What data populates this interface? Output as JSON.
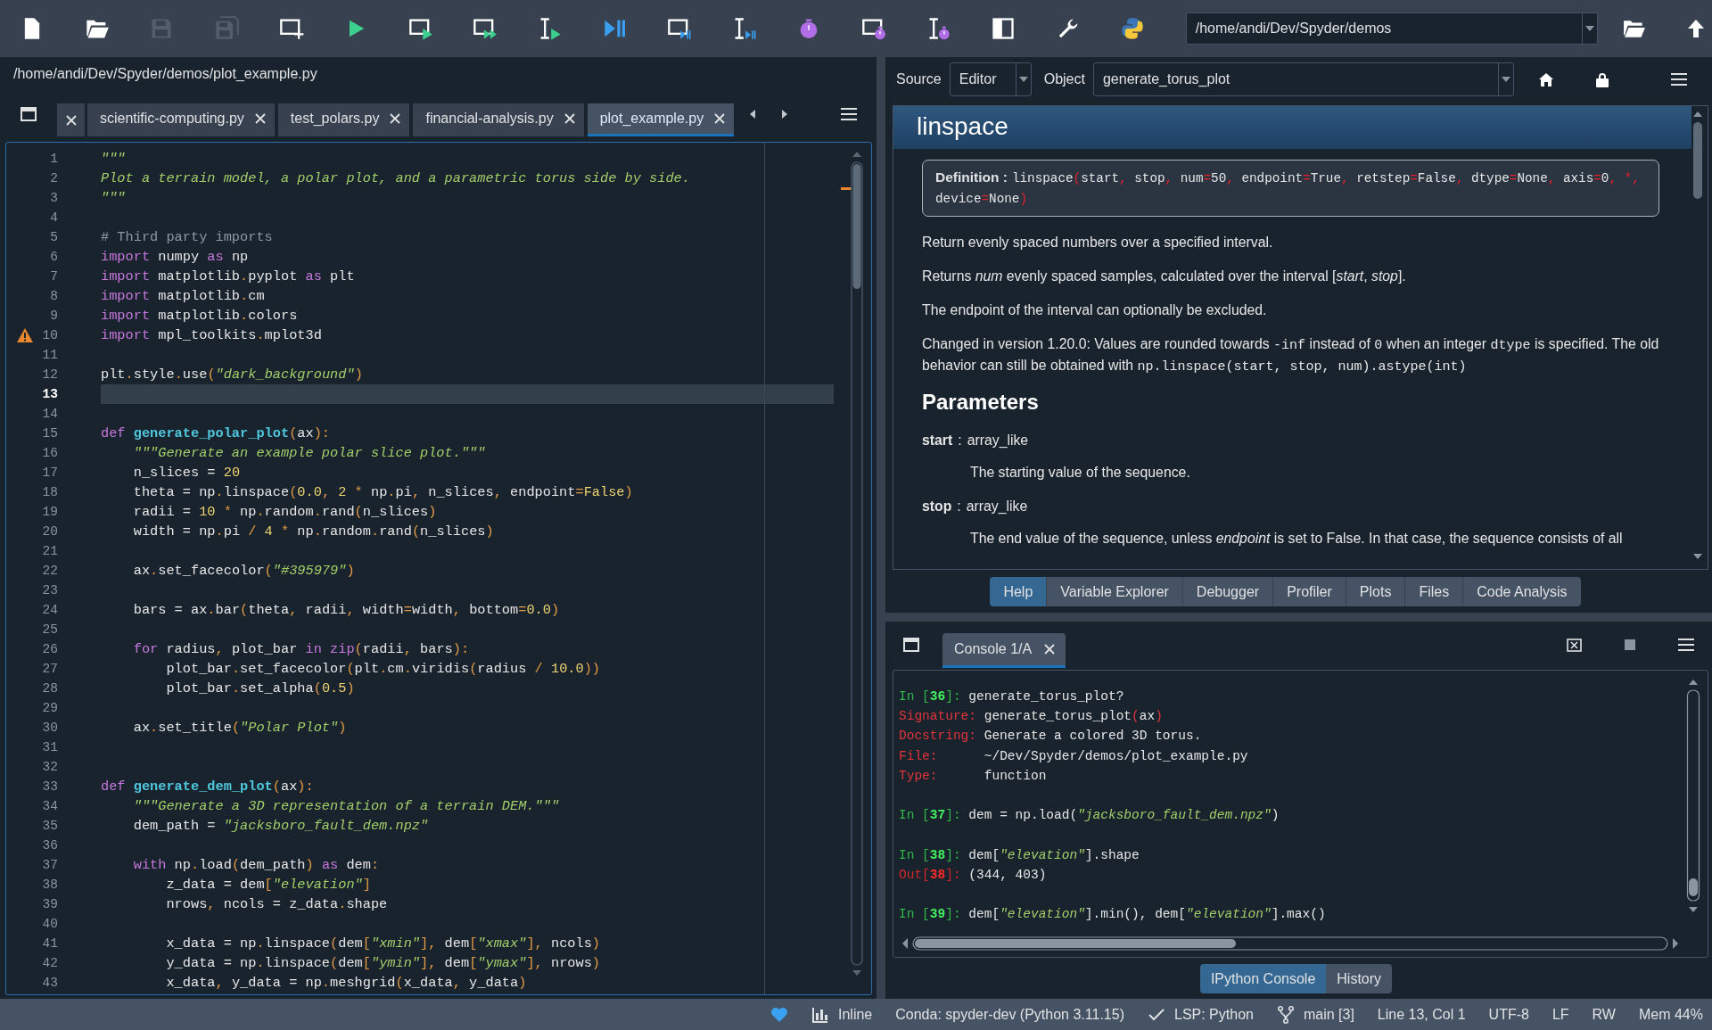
{
  "toolbar": {
    "buttons": [
      {
        "kind": "new",
        "disabled": false
      },
      {
        "kind": "open",
        "disabled": false
      },
      {
        "kind": "save",
        "disabled": true
      },
      {
        "kind": "saveall",
        "disabled": true
      },
      {
        "kind": "newcell",
        "disabled": false
      },
      {
        "kind": "run",
        "disabled": false
      },
      {
        "kind": "runcell",
        "disabled": false
      },
      {
        "kind": "runadvance",
        "disabled": false
      },
      {
        "kind": "runselection",
        "disabled": false
      },
      {
        "kind": "debug",
        "disabled": false
      },
      {
        "kind": "debugcell",
        "disabled": false
      },
      {
        "kind": "debugselection",
        "disabled": false
      },
      {
        "kind": "profile",
        "disabled": false
      },
      {
        "kind": "profilecell",
        "disabled": false
      },
      {
        "kind": "profileselection",
        "disabled": false
      },
      {
        "kind": "maximize",
        "disabled": false
      },
      {
        "kind": "preferences",
        "disabled": false
      },
      {
        "kind": "pythonpath",
        "disabled": false
      }
    ],
    "path": "/home/andi/Dev/Spyder/demos"
  },
  "editor": {
    "file_path": "/home/andi/Dev/Spyder/demos/plot_example.py",
    "tabs": [
      {
        "label": "scientific-computing.py",
        "selected": false
      },
      {
        "label": "test_polars.py",
        "selected": false
      },
      {
        "label": "financial-analysis.py",
        "selected": false
      },
      {
        "label": "plot_example.py",
        "selected": true
      }
    ],
    "lines": [
      {
        "n": "1",
        "current": false,
        "warning": false,
        "tokens": [
          {
            "kind": "string",
            "text": "\"\"\""
          }
        ]
      },
      {
        "n": "2",
        "current": false,
        "warning": false,
        "tokens": [
          {
            "kind": "string",
            "text": "Plot a terrain model, a polar plot, and a parametric torus side by side."
          }
        ]
      },
      {
        "n": "3",
        "current": false,
        "warning": false,
        "tokens": [
          {
            "kind": "string",
            "text": "\"\"\""
          }
        ]
      },
      {
        "n": "4",
        "current": false,
        "warning": false
      },
      {
        "n": "5",
        "current": false,
        "warning": false,
        "tokens": [
          {
            "kind": "comment",
            "text": "# Third party imports"
          }
        ]
      },
      {
        "n": "6",
        "current": false,
        "warning": false,
        "tokens": [
          {
            "kind": "keyword",
            "text": "import"
          },
          {
            "kind": "plain",
            "text": " numpy "
          },
          {
            "kind": "keyword",
            "text": "as"
          },
          {
            "kind": "plain",
            "text": " np"
          }
        ]
      },
      {
        "n": "7",
        "current": false,
        "warning": false,
        "tokens": [
          {
            "kind": "keyword",
            "text": "import"
          },
          {
            "kind": "plain",
            "text": " matplotlib"
          },
          {
            "kind": "punct",
            "text": "."
          },
          {
            "kind": "plain",
            "text": "pyplot "
          },
          {
            "kind": "keyword",
            "text": "as"
          },
          {
            "kind": "plain",
            "text": " plt"
          }
        ]
      },
      {
        "n": "8",
        "current": false,
        "warning": false,
        "tokens": [
          {
            "kind": "keyword",
            "text": "import"
          },
          {
            "kind": "plain",
            "text": " matplotlib"
          },
          {
            "kind": "punct",
            "text": "."
          },
          {
            "kind": "plain",
            "text": "cm"
          }
        ]
      },
      {
        "n": "9",
        "current": false,
        "warning": false,
        "tokens": [
          {
            "kind": "keyword",
            "text": "import"
          },
          {
            "kind": "plain",
            "text": " matplotlib"
          },
          {
            "kind": "punct",
            "text": "."
          },
          {
            "kind": "plain",
            "text": "colors"
          }
        ]
      },
      {
        "n": "10",
        "current": false,
        "warning": true,
        "tokens": [
          {
            "kind": "keyword",
            "text": "import"
          },
          {
            "kind": "plain",
            "text": " mpl_toolkits"
          },
          {
            "kind": "punct",
            "text": "."
          },
          {
            "kind": "plain",
            "text": "mplot3d"
          }
        ]
      },
      {
        "n": "11",
        "current": false,
        "warning": false
      },
      {
        "n": "12",
        "current": false,
        "warning": false,
        "tokens": [
          {
            "kind": "plain",
            "text": "plt"
          },
          {
            "kind": "punct",
            "text": "."
          },
          {
            "kind": "plain",
            "text": "style"
          },
          {
            "kind": "punct",
            "text": "."
          },
          {
            "kind": "plain",
            "text": "use"
          },
          {
            "kind": "punct",
            "text": "("
          },
          {
            "kind": "string",
            "text": "\"dark_background\""
          },
          {
            "kind": "punct",
            "text": ")"
          }
        ]
      },
      {
        "n": "13",
        "current": true,
        "warning": false
      },
      {
        "n": "14",
        "current": false,
        "warning": false
      },
      {
        "n": "15",
        "current": false,
        "warning": false,
        "tokens": [
          {
            "kind": "keyword",
            "text": "def "
          },
          {
            "kind": "function",
            "text": "generate_polar_plot"
          },
          {
            "kind": "punct",
            "text": "("
          },
          {
            "kind": "plain",
            "text": "ax"
          },
          {
            "kind": "punct",
            "text": "):"
          }
        ]
      },
      {
        "n": "16",
        "current": false,
        "warning": false,
        "tokens": [
          {
            "kind": "string",
            "text": "    \"\"\"Generate an example polar slice plot.\"\"\""
          }
        ]
      },
      {
        "n": "17",
        "current": false,
        "warning": false,
        "tokens": [
          {
            "kind": "plain",
            "text": "    n_slices = "
          },
          {
            "kind": "number",
            "text": "20"
          }
        ]
      },
      {
        "n": "18",
        "current": false,
        "warning": false,
        "tokens": [
          {
            "kind": "plain",
            "text": "    theta = np"
          },
          {
            "kind": "punct",
            "text": "."
          },
          {
            "kind": "plain",
            "text": "linspace"
          },
          {
            "kind": "punct",
            "text": "("
          },
          {
            "kind": "number",
            "text": "0.0"
          },
          {
            "kind": "punct",
            "text": ", "
          },
          {
            "kind": "number",
            "text": "2"
          },
          {
            "kind": "punct",
            "text": " * "
          },
          {
            "kind": "plain",
            "text": "np"
          },
          {
            "kind": "punct",
            "text": "."
          },
          {
            "kind": "plain",
            "text": "pi"
          },
          {
            "kind": "punct",
            "text": ", "
          },
          {
            "kind": "plain",
            "text": "n_slices"
          },
          {
            "kind": "punct",
            "text": ", "
          },
          {
            "kind": "plain",
            "text": "endpoint"
          },
          {
            "kind": "punct",
            "text": "="
          },
          {
            "kind": "number",
            "text": "False"
          },
          {
            "kind": "punct",
            "text": ")"
          }
        ]
      },
      {
        "n": "19",
        "current": false,
        "warning": false,
        "tokens": [
          {
            "kind": "plain",
            "text": "    radii = "
          },
          {
            "kind": "number",
            "text": "10"
          },
          {
            "kind": "punct",
            "text": " * "
          },
          {
            "kind": "plain",
            "text": "np"
          },
          {
            "kind": "punct",
            "text": "."
          },
          {
            "kind": "plain",
            "text": "random"
          },
          {
            "kind": "punct",
            "text": "."
          },
          {
            "kind": "plain",
            "text": "rand"
          },
          {
            "kind": "punct",
            "text": "("
          },
          {
            "kind": "plain",
            "text": "n_slices"
          },
          {
            "kind": "punct",
            "text": ")"
          }
        ]
      },
      {
        "n": "20",
        "current": false,
        "warning": false,
        "tokens": [
          {
            "kind": "plain",
            "text": "    width = np"
          },
          {
            "kind": "punct",
            "text": "."
          },
          {
            "kind": "plain",
            "text": "pi"
          },
          {
            "kind": "punct",
            "text": " / "
          },
          {
            "kind": "number",
            "text": "4"
          },
          {
            "kind": "punct",
            "text": " * "
          },
          {
            "kind": "plain",
            "text": "np"
          },
          {
            "kind": "punct",
            "text": "."
          },
          {
            "kind": "plain",
            "text": "random"
          },
          {
            "kind": "punct",
            "text": "."
          },
          {
            "kind": "plain",
            "text": "rand"
          },
          {
            "kind": "punct",
            "text": "("
          },
          {
            "kind": "plain",
            "text": "n_slices"
          },
          {
            "kind": "punct",
            "text": ")"
          }
        ]
      },
      {
        "n": "21",
        "current": false,
        "warning": false
      },
      {
        "n": "22",
        "current": false,
        "warning": false,
        "tokens": [
          {
            "kind": "plain",
            "text": "    ax"
          },
          {
            "kind": "punct",
            "text": "."
          },
          {
            "kind": "plain",
            "text": "set_facecolor"
          },
          {
            "kind": "punct",
            "text": "("
          },
          {
            "kind": "string",
            "text": "\"#395979\""
          },
          {
            "kind": "punct",
            "text": ")"
          }
        ]
      },
      {
        "n": "23",
        "current": false,
        "warning": false
      },
      {
        "n": "24",
        "current": false,
        "warning": false,
        "tokens": [
          {
            "kind": "plain",
            "text": "    bars = ax"
          },
          {
            "kind": "punct",
            "text": "."
          },
          {
            "kind": "plain",
            "text": "bar"
          },
          {
            "kind": "punct",
            "text": "("
          },
          {
            "kind": "plain",
            "text": "theta"
          },
          {
            "kind": "punct",
            "text": ", "
          },
          {
            "kind": "plain",
            "text": "radii"
          },
          {
            "kind": "punct",
            "text": ", "
          },
          {
            "kind": "plain",
            "text": "width"
          },
          {
            "kind": "punct",
            "text": "="
          },
          {
            "kind": "plain",
            "text": "width"
          },
          {
            "kind": "punct",
            "text": ", "
          },
          {
            "kind": "plain",
            "text": "bottom"
          },
          {
            "kind": "punct",
            "text": "="
          },
          {
            "kind": "number",
            "text": "0.0"
          },
          {
            "kind": "punct",
            "text": ")"
          }
        ]
      },
      {
        "n": "25",
        "current": false,
        "warning": false
      },
      {
        "n": "26",
        "current": false,
        "warning": false,
        "tokens": [
          {
            "kind": "keyword",
            "text": "    for"
          },
          {
            "kind": "plain",
            "text": " radius"
          },
          {
            "kind": "punct",
            "text": ", "
          },
          {
            "kind": "plain",
            "text": "plot_bar "
          },
          {
            "kind": "keyword",
            "text": "in zip"
          },
          {
            "kind": "punct",
            "text": "("
          },
          {
            "kind": "plain",
            "text": "radii"
          },
          {
            "kind": "punct",
            "text": ", "
          },
          {
            "kind": "plain",
            "text": "bars"
          },
          {
            "kind": "punct",
            "text": "):"
          }
        ]
      },
      {
        "n": "27",
        "current": false,
        "warning": false,
        "tokens": [
          {
            "kind": "plain",
            "text": "        plot_bar"
          },
          {
            "kind": "punct",
            "text": "."
          },
          {
            "kind": "plain",
            "text": "set_facecolor"
          },
          {
            "kind": "punct",
            "text": "("
          },
          {
            "kind": "plain",
            "text": "plt"
          },
          {
            "kind": "punct",
            "text": "."
          },
          {
            "kind": "plain",
            "text": "cm"
          },
          {
            "kind": "punct",
            "text": "."
          },
          {
            "kind": "plain",
            "text": "viridis"
          },
          {
            "kind": "punct",
            "text": "("
          },
          {
            "kind": "plain",
            "text": "radius"
          },
          {
            "kind": "punct",
            "text": " / "
          },
          {
            "kind": "number",
            "text": "10.0"
          },
          {
            "kind": "punct",
            "text": "))"
          }
        ]
      },
      {
        "n": "28",
        "current": false,
        "warning": false,
        "tokens": [
          {
            "kind": "plain",
            "text": "        plot_bar"
          },
          {
            "kind": "punct",
            "text": "."
          },
          {
            "kind": "plain",
            "text": "set_alpha"
          },
          {
            "kind": "punct",
            "text": "("
          },
          {
            "kind": "number",
            "text": "0.5"
          },
          {
            "kind": "punct",
            "text": ")"
          }
        ]
      },
      {
        "n": "29",
        "current": false,
        "warning": false
      },
      {
        "n": "30",
        "current": false,
        "warning": false,
        "tokens": [
          {
            "kind": "plain",
            "text": "    ax"
          },
          {
            "kind": "punct",
            "text": "."
          },
          {
            "kind": "plain",
            "text": "set_title"
          },
          {
            "kind": "punct",
            "text": "("
          },
          {
            "kind": "string",
            "text": "\"Polar Plot\""
          },
          {
            "kind": "punct",
            "text": ")"
          }
        ]
      },
      {
        "n": "31",
        "current": false,
        "warning": false
      },
      {
        "n": "32",
        "current": false,
        "warning": false
      },
      {
        "n": "33",
        "current": false,
        "warning": false,
        "tokens": [
          {
            "kind": "keyword",
            "text": "def "
          },
          {
            "kind": "function",
            "text": "generate_dem_plot"
          },
          {
            "kind": "punct",
            "text": "("
          },
          {
            "kind": "plain",
            "text": "ax"
          },
          {
            "kind": "punct",
            "text": "):"
          }
        ]
      },
      {
        "n": "34",
        "current": false,
        "warning": false,
        "tokens": [
          {
            "kind": "string",
            "text": "    \"\"\"Generate a 3D representation of a terrain DEM.\"\"\""
          }
        ]
      },
      {
        "n": "35",
        "current": false,
        "warning": false,
        "tokens": [
          {
            "kind": "plain",
            "text": "    dem_path = "
          },
          {
            "kind": "string",
            "text": "\"jacksboro_fault_dem.npz\""
          }
        ]
      },
      {
        "n": "36",
        "current": false,
        "warning": false
      },
      {
        "n": "37",
        "current": false,
        "warning": false,
        "tokens": [
          {
            "kind": "keyword",
            "text": "    with"
          },
          {
            "kind": "plain",
            "text": " np"
          },
          {
            "kind": "punct",
            "text": "."
          },
          {
            "kind": "plain",
            "text": "load"
          },
          {
            "kind": "punct",
            "text": "("
          },
          {
            "kind": "plain",
            "text": "dem_path"
          },
          {
            "kind": "punct",
            "text": ")"
          },
          {
            "kind": "keyword",
            "text": " as"
          },
          {
            "kind": "plain",
            "text": " dem"
          },
          {
            "kind": "punct",
            "text": ":"
          }
        ]
      },
      {
        "n": "38",
        "current": false,
        "warning": false,
        "tokens": [
          {
            "kind": "plain",
            "text": "        z_data = dem"
          },
          {
            "kind": "punct",
            "text": "["
          },
          {
            "kind": "string",
            "text": "\"elevation\""
          },
          {
            "kind": "punct",
            "text": "]"
          }
        ]
      },
      {
        "n": "39",
        "current": false,
        "warning": false,
        "tokens": [
          {
            "kind": "plain",
            "text": "        nrows"
          },
          {
            "kind": "punct",
            "text": ", "
          },
          {
            "kind": "plain",
            "text": "ncols = z_data"
          },
          {
            "kind": "punct",
            "text": "."
          },
          {
            "kind": "plain",
            "text": "shape"
          }
        ]
      },
      {
        "n": "40",
        "current": false,
        "warning": false
      },
      {
        "n": "41",
        "current": false,
        "warning": false,
        "tokens": [
          {
            "kind": "plain",
            "text": "        x_data = np"
          },
          {
            "kind": "punct",
            "text": "."
          },
          {
            "kind": "plain",
            "text": "linspace"
          },
          {
            "kind": "punct",
            "text": "("
          },
          {
            "kind": "plain",
            "text": "dem"
          },
          {
            "kind": "punct",
            "text": "["
          },
          {
            "kind": "string",
            "text": "\"xmin\""
          },
          {
            "kind": "punct",
            "text": "], "
          },
          {
            "kind": "plain",
            "text": "dem"
          },
          {
            "kind": "punct",
            "text": "["
          },
          {
            "kind": "string",
            "text": "\"xmax\""
          },
          {
            "kind": "punct",
            "text": "], "
          },
          {
            "kind": "plain",
            "text": "ncols"
          },
          {
            "kind": "punct",
            "text": ")"
          }
        ]
      },
      {
        "n": "42",
        "current": false,
        "warning": false,
        "tokens": [
          {
            "kind": "plain",
            "text": "        y_data = np"
          },
          {
            "kind": "punct",
            "text": "."
          },
          {
            "kind": "plain",
            "text": "linspace"
          },
          {
            "kind": "punct",
            "text": "("
          },
          {
            "kind": "plain",
            "text": "dem"
          },
          {
            "kind": "punct",
            "text": "["
          },
          {
            "kind": "string",
            "text": "\"ymin\""
          },
          {
            "kind": "punct",
            "text": "], "
          },
          {
            "kind": "plain",
            "text": "dem"
          },
          {
            "kind": "punct",
            "text": "["
          },
          {
            "kind": "string",
            "text": "\"ymax\""
          },
          {
            "kind": "punct",
            "text": "], "
          },
          {
            "kind": "plain",
            "text": "nrows"
          },
          {
            "kind": "punct",
            "text": ")"
          }
        ]
      },
      {
        "n": "43",
        "current": false,
        "warning": false,
        "tokens": [
          {
            "kind": "plain",
            "text": "        x_data"
          },
          {
            "kind": "punct",
            "text": ", "
          },
          {
            "kind": "plain",
            "text": "y_data = np"
          },
          {
            "kind": "punct",
            "text": "."
          },
          {
            "kind": "plain",
            "text": "meshgrid"
          },
          {
            "kind": "punct",
            "text": "("
          },
          {
            "kind": "plain",
            "text": "x_data"
          },
          {
            "kind": "punct",
            "text": ", "
          },
          {
            "kind": "plain",
            "text": "y_data"
          },
          {
            "kind": "punct",
            "text": ")"
          }
        ]
      }
    ]
  },
  "help": {
    "source_label": "Source",
    "source": "Editor",
    "object_label": "Object",
    "object": "generate_torus_plot",
    "title": "linspace",
    "definition_label": "Definition :",
    "definition": [
      {
        "kind": "plain",
        "text": "linspace"
      },
      {
        "kind": "punct",
        "text": "("
      },
      {
        "kind": "plain",
        "text": "start"
      },
      {
        "kind": "punct",
        "text": ", "
      },
      {
        "kind": "plain",
        "text": "stop"
      },
      {
        "kind": "punct",
        "text": ", "
      },
      {
        "kind": "plain",
        "text": "num"
      },
      {
        "kind": "punct",
        "text": "="
      },
      {
        "kind": "plain",
        "text": "50"
      },
      {
        "kind": "punct",
        "text": ", "
      },
      {
        "kind": "plain",
        "text": "endpoint"
      },
      {
        "kind": "punct",
        "text": "="
      },
      {
        "kind": "plain",
        "text": "True"
      },
      {
        "kind": "punct",
        "text": ", "
      },
      {
        "kind": "plain",
        "text": "retstep"
      },
      {
        "kind": "punct",
        "text": "="
      },
      {
        "kind": "plain",
        "text": "False"
      },
      {
        "kind": "punct",
        "text": ", "
      },
      {
        "kind": "plain",
        "text": "dtype"
      },
      {
        "kind": "punct",
        "text": "="
      },
      {
        "kind": "plain",
        "text": "None"
      },
      {
        "kind": "punct",
        "text": ", "
      },
      {
        "kind": "plain",
        "text": "axis"
      },
      {
        "kind": "punct",
        "text": "="
      },
      {
        "kind": "plain",
        "text": "0"
      },
      {
        "kind": "punct",
        "text": ", *, "
      },
      {
        "kind": "plain",
        "text": "device"
      },
      {
        "kind": "punct",
        "text": "="
      },
      {
        "kind": "plain",
        "text": "None"
      },
      {
        "kind": "punct",
        "text": ")"
      }
    ],
    "paragraphs": [
      [
        {
          "kind": "text",
          "text": "Return evenly spaced numbers over a specified interval."
        }
      ],
      [
        {
          "kind": "text",
          "text": "Returns *num* evenly spaced samples, calculated over the interval [*start*, *stop*]."
        }
      ],
      [
        {
          "kind": "text",
          "text": "The endpoint of the interval can optionally be excluded."
        }
      ],
      [
        {
          "kind": "text",
          "text": "Changed in version 1.20.0: Values are rounded towards "
        },
        {
          "kind": "code",
          "text": "-inf"
        },
        {
          "kind": "text",
          "text": " instead of "
        },
        {
          "kind": "code",
          "text": "0"
        },
        {
          "kind": "text",
          "text": " when an integer "
        },
        {
          "kind": "code",
          "text": "dtype"
        },
        {
          "kind": "text",
          "text": " is specified. The old behavior can still be obtained with "
        },
        {
          "kind": "code",
          "text": "np.linspace(start, stop, num).astype(int)"
        }
      ]
    ],
    "params_heading": "Parameters",
    "params": [
      {
        "name": "start",
        "separator": ":",
        "type": "array_like",
        "description": "The starting value of the sequence."
      },
      {
        "name": "stop",
        "separator": ":",
        "type": "array_like",
        "description": "The end value of the sequence, unless *endpoint* is set to False. In that case, the sequence consists of all"
      }
    ]
  },
  "pane_tabs": [
    {
      "label": "Help",
      "selected": true
    },
    {
      "label": "Variable Explorer",
      "selected": false
    },
    {
      "label": "Debugger",
      "selected": false
    },
    {
      "label": "Profiler",
      "selected": false
    },
    {
      "label": "Plots",
      "selected": false
    },
    {
      "label": "Files",
      "selected": false
    },
    {
      "label": "Code Analysis",
      "selected": false
    }
  ],
  "console": {
    "tab": "Console 1/A",
    "blocks": [
      [
        [
          {
            "kind": "prompt",
            "text": "In ["
          },
          {
            "kind": "prompt_number",
            "text": "36"
          },
          {
            "kind": "prompt",
            "text": "]: "
          },
          {
            "kind": "plain",
            "text": "generate_torus_plot?"
          }
        ],
        [
          {
            "kind": "label",
            "text": "Signature: "
          },
          {
            "kind": "plain",
            "text": "generate_torus_plot"
          },
          {
            "kind": "punct",
            "text": "("
          },
          {
            "kind": "plain",
            "text": "ax"
          },
          {
            "kind": "punct",
            "text": ")"
          }
        ],
        [
          {
            "kind": "label",
            "text": "Docstring: "
          },
          {
            "kind": "plain",
            "text": "Generate a colored 3D torus."
          }
        ],
        [
          {
            "kind": "label",
            "text": "File:"
          },
          {
            "kind": "plain",
            "text": "      ~/Dev/Spyder/demos/plot_example.py"
          }
        ],
        [
          {
            "kind": "label",
            "text": "Type:"
          },
          {
            "kind": "plain",
            "text": "      function"
          }
        ]
      ],
      [
        [
          {
            "kind": "prompt",
            "text": "In ["
          },
          {
            "kind": "prompt_number",
            "text": "37"
          },
          {
            "kind": "prompt",
            "text": "]: "
          },
          {
            "kind": "plain",
            "text": "dem = np.load("
          },
          {
            "kind": "string",
            "text": "\"jacksboro_fault_dem.npz\""
          },
          {
            "kind": "plain",
            "text": ")"
          }
        ]
      ],
      [
        [
          {
            "kind": "prompt",
            "text": "In ["
          },
          {
            "kind": "prompt_number",
            "text": "38"
          },
          {
            "kind": "prompt",
            "text": "]: "
          },
          {
            "kind": "plain",
            "text": "dem["
          },
          {
            "kind": "string",
            "text": "\"elevation\""
          },
          {
            "kind": "plain",
            "text": "].shape"
          }
        ],
        [
          {
            "kind": "out",
            "text": "Out["
          },
          {
            "kind": "out_number",
            "text": "38"
          },
          {
            "kind": "out",
            "text": "]: "
          },
          {
            "kind": "plain",
            "text": "(344, 403)"
          }
        ]
      ],
      [
        [
          {
            "kind": "prompt",
            "text": "In ["
          },
          {
            "kind": "prompt_number",
            "text": "39"
          },
          {
            "kind": "prompt",
            "text": "]: "
          },
          {
            "kind": "plain",
            "text": "dem["
          },
          {
            "kind": "string",
            "text": "\"elevation\""
          },
          {
            "kind": "plain",
            "text": "].min(), dem["
          },
          {
            "kind": "string",
            "text": "\"elevation\""
          },
          {
            "kind": "plain",
            "text": "].max()"
          }
        ]
      ]
    ]
  },
  "console_tabs": [
    {
      "label": "IPython Console",
      "selected": true
    },
    {
      "label": "History",
      "selected": false
    }
  ],
  "status_bar": [
    {
      "kind": "heart"
    },
    {
      "kind": "plots",
      "text": "Inline"
    },
    {
      "kind": "env",
      "text": "Conda: spyder-dev (Python 3.11.15)"
    },
    {
      "kind": "lsp",
      "text": "LSP: Python"
    },
    {
      "kind": "git",
      "text": "main [3]"
    },
    {
      "kind": "cursor",
      "text": "Line 13, Col 1"
    },
    {
      "kind": "encoding",
      "text": "UTF-8"
    },
    {
      "kind": "eol",
      "text": "LF"
    },
    {
      "kind": "perm",
      "text": "RW"
    },
    {
      "kind": "memory",
      "text": "Mem 44%"
    }
  ]
}
